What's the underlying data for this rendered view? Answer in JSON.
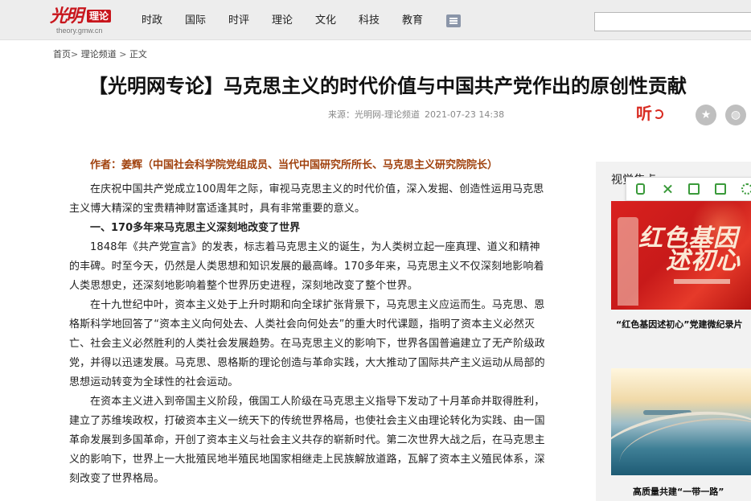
{
  "header": {
    "logo_mark": "光明",
    "logo_tag": "理论",
    "logo_sub": "theory.gmw.cn",
    "nav": [
      "时政",
      "国际",
      "时评",
      "理论",
      "文化",
      "科技",
      "教育"
    ],
    "search_value": ""
  },
  "breadcrumb": {
    "home": "首页",
    "channel": "理论频道",
    "current": "正文",
    "sep1": ">",
    "sep2": ">"
  },
  "article": {
    "title": "【光明网专论】马克思主义的时代价值与中国共产党作出的原创性贡献",
    "source": "来源：光明网-理论频道",
    "date": "2021-07-23 14:38",
    "listen_label": "听",
    "author": "作者：姜辉（中国社会科学院党组成员、当代中国研究所所长、马克思主义研究院院长）",
    "paragraphs": [
      "在庆祝中国共产党成立100周年之际，审视马克思主义的时代价值，深入发掘、创造性运用马克思主义博大精深的宝贵精神财富适逢其时，具有非常重要的意义。",
      "一、170多年来马克思主义深刻地改变了世界",
      "1848年《共产党宣言》的发表，标志着马克思主义的诞生，为人类树立起一座真理、道义和精神的丰碑。时至今天，仍然是人类思想和知识发展的最高峰。170多年来，马克思主义不仅深刻地影响着人类思想史，还深刻地影响着整个世界历史进程，深刻地改变了整个世界。",
      "在十九世纪中叶，资本主义处于上升时期和向全球扩张背景下，马克思主义应运而生。马克思、恩格斯科学地回答了“资本主义向何处去、人类社会向何处去”的重大时代课题，指明了资本主义必然灭亡、社会主义必然胜利的人类社会发展趋势。在马克思主义的影响下，世界各国普遍建立了无产阶级政党，并得以迅速发展。马克思、恩格斯的理论创造与革命实践，大大推动了国际共产主义运动从局部的思想运动转变为全球性的社会运动。",
      "在资本主义进入到帝国主义阶段，俄国工人阶级在马克思主义指导下发动了十月革命并取得胜利，建立了苏维埃政权，打破资本主义一统天下的传统世界格局，也使社会主义由理论转化为实践、由一国革命发展到多国革命，开创了资本主义与社会主义共存的崭新时代。第二次世界大战之后，在马克思主义的影响下，世界上一大批殖民地半殖民地国家相继走上民族解放道路，瓦解了资本主义殖民体系，深刻改变了世界格局。"
    ]
  },
  "sidebar": {
    "title": "视觉焦点",
    "items": [
      {
        "image_text_1": "红色基因",
        "image_text_2": "述初心",
        "caption": "“红色基因述初心”党建微纪录片"
      },
      {
        "caption": "高质量共建“一带一路”"
      }
    ]
  },
  "colors": {
    "brand_red": "#c8161d",
    "author_brown": "#a0410d",
    "toolbar_green": "#3a9a3a"
  }
}
